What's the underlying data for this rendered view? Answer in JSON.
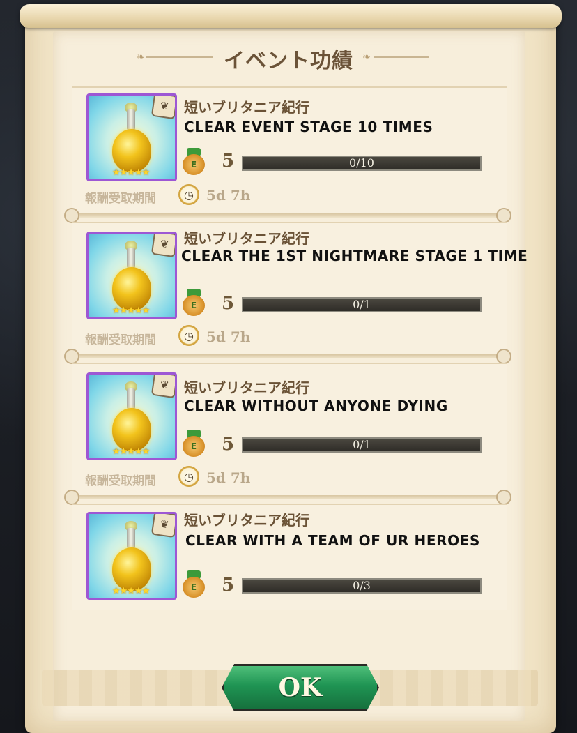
{
  "dialog": {
    "title": "イベント功績"
  },
  "achievements": [
    {
      "category": "短いブリタニア紀行",
      "description": "CLEAR EVENT STAGE 10 TIMES",
      "reward_amount": "5",
      "progress_text": "0/10",
      "progress_fraction": 0,
      "period_label": "報酬受取期間",
      "time_remaining": "5d 7h",
      "item_stars": "★★★★★"
    },
    {
      "category": "短いブリタニア紀行",
      "description": "CLEAR THE 1ST NIGHTMARE STAGE 1 TIME",
      "reward_amount": "5",
      "progress_text": "0/1",
      "progress_fraction": 0,
      "period_label": "報酬受取期間",
      "time_remaining": "5d 7h",
      "item_stars": "★★★★★"
    },
    {
      "category": "短いブリタニア紀行",
      "description": "CLEAR WITHOUT ANYONE DYING",
      "reward_amount": "5",
      "progress_text": "0/1",
      "progress_fraction": 0,
      "period_label": "報酬受取期間",
      "time_remaining": "5d 7h",
      "item_stars": "★★★★★"
    },
    {
      "category": "短いブリタニア紀行",
      "description": "CLEAR WITH A TEAM OF UR HEROES",
      "reward_amount": "5",
      "progress_text": "0/3",
      "progress_fraction": 0,
      "item_stars": "★★★★★"
    }
  ],
  "footer": {
    "ok_label": "OK"
  },
  "icons": {
    "medal_letter": "E",
    "corner_badge_glyph": "❦",
    "clock_glyph": "◷"
  },
  "colors": {
    "ok_button": "#1f9453",
    "item_border": "#9d57d4",
    "progress_bar": "#3a3731"
  }
}
